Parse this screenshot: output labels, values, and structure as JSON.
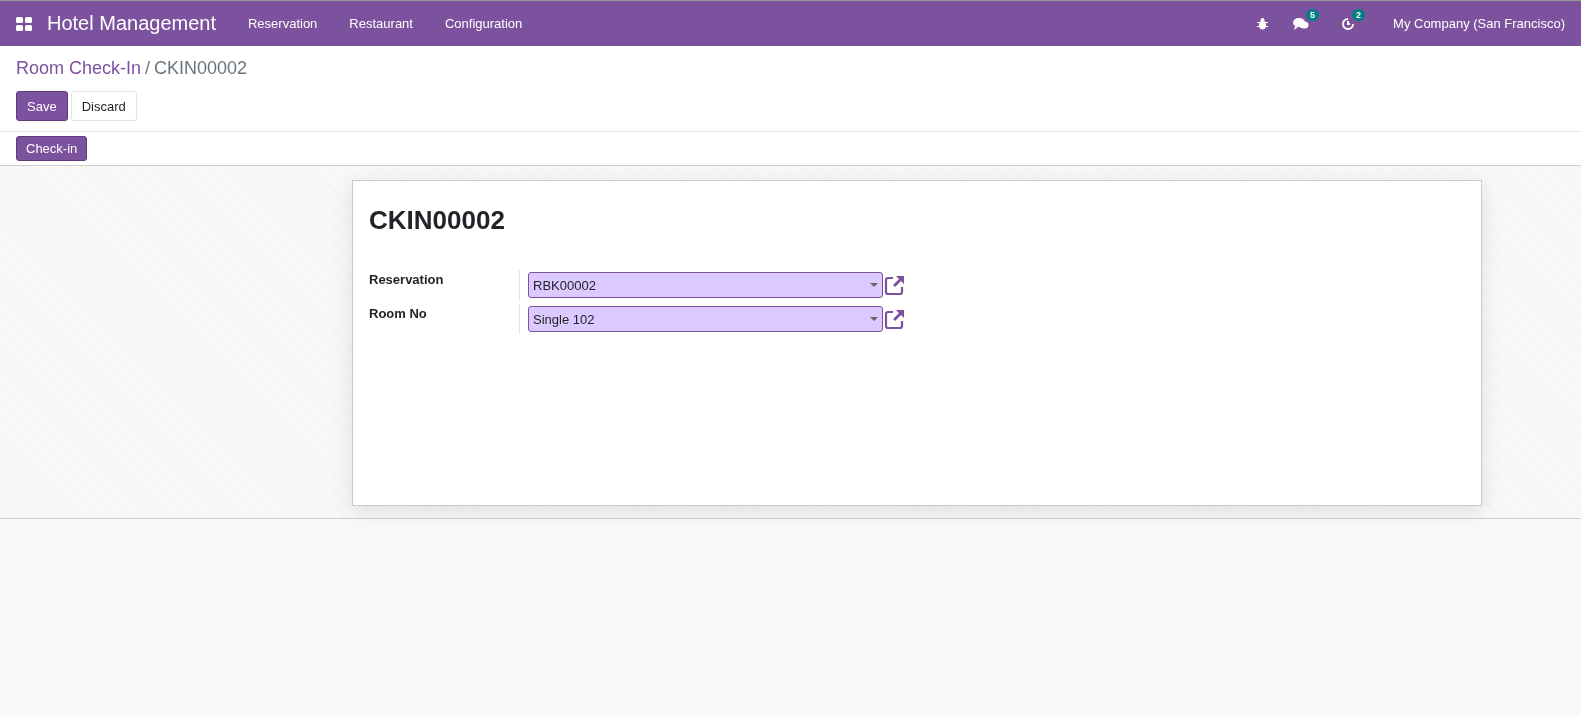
{
  "navbar": {
    "app_title": "Hotel Management",
    "menu": [
      "Reservation",
      "Restaurant",
      "Configuration"
    ],
    "messages_count": "5",
    "activities_count": "2",
    "company": "My Company (San Francisco)"
  },
  "breadcrumb": {
    "parent": "Room Check-In",
    "separator": "/",
    "current": "CKIN00002"
  },
  "buttons": [
    {
      "label": "Save",
      "kind": "primary"
    },
    {
      "label": "Discard",
      "kind": "secondary"
    }
  ],
  "status_bar": {
    "buttons": [
      "Check-in"
    ]
  },
  "form": {
    "title": "CKIN00002",
    "fields": [
      {
        "label": "Reservation",
        "value": "RBK00002"
      },
      {
        "label": "Room No",
        "value": "Single 102"
      }
    ]
  }
}
